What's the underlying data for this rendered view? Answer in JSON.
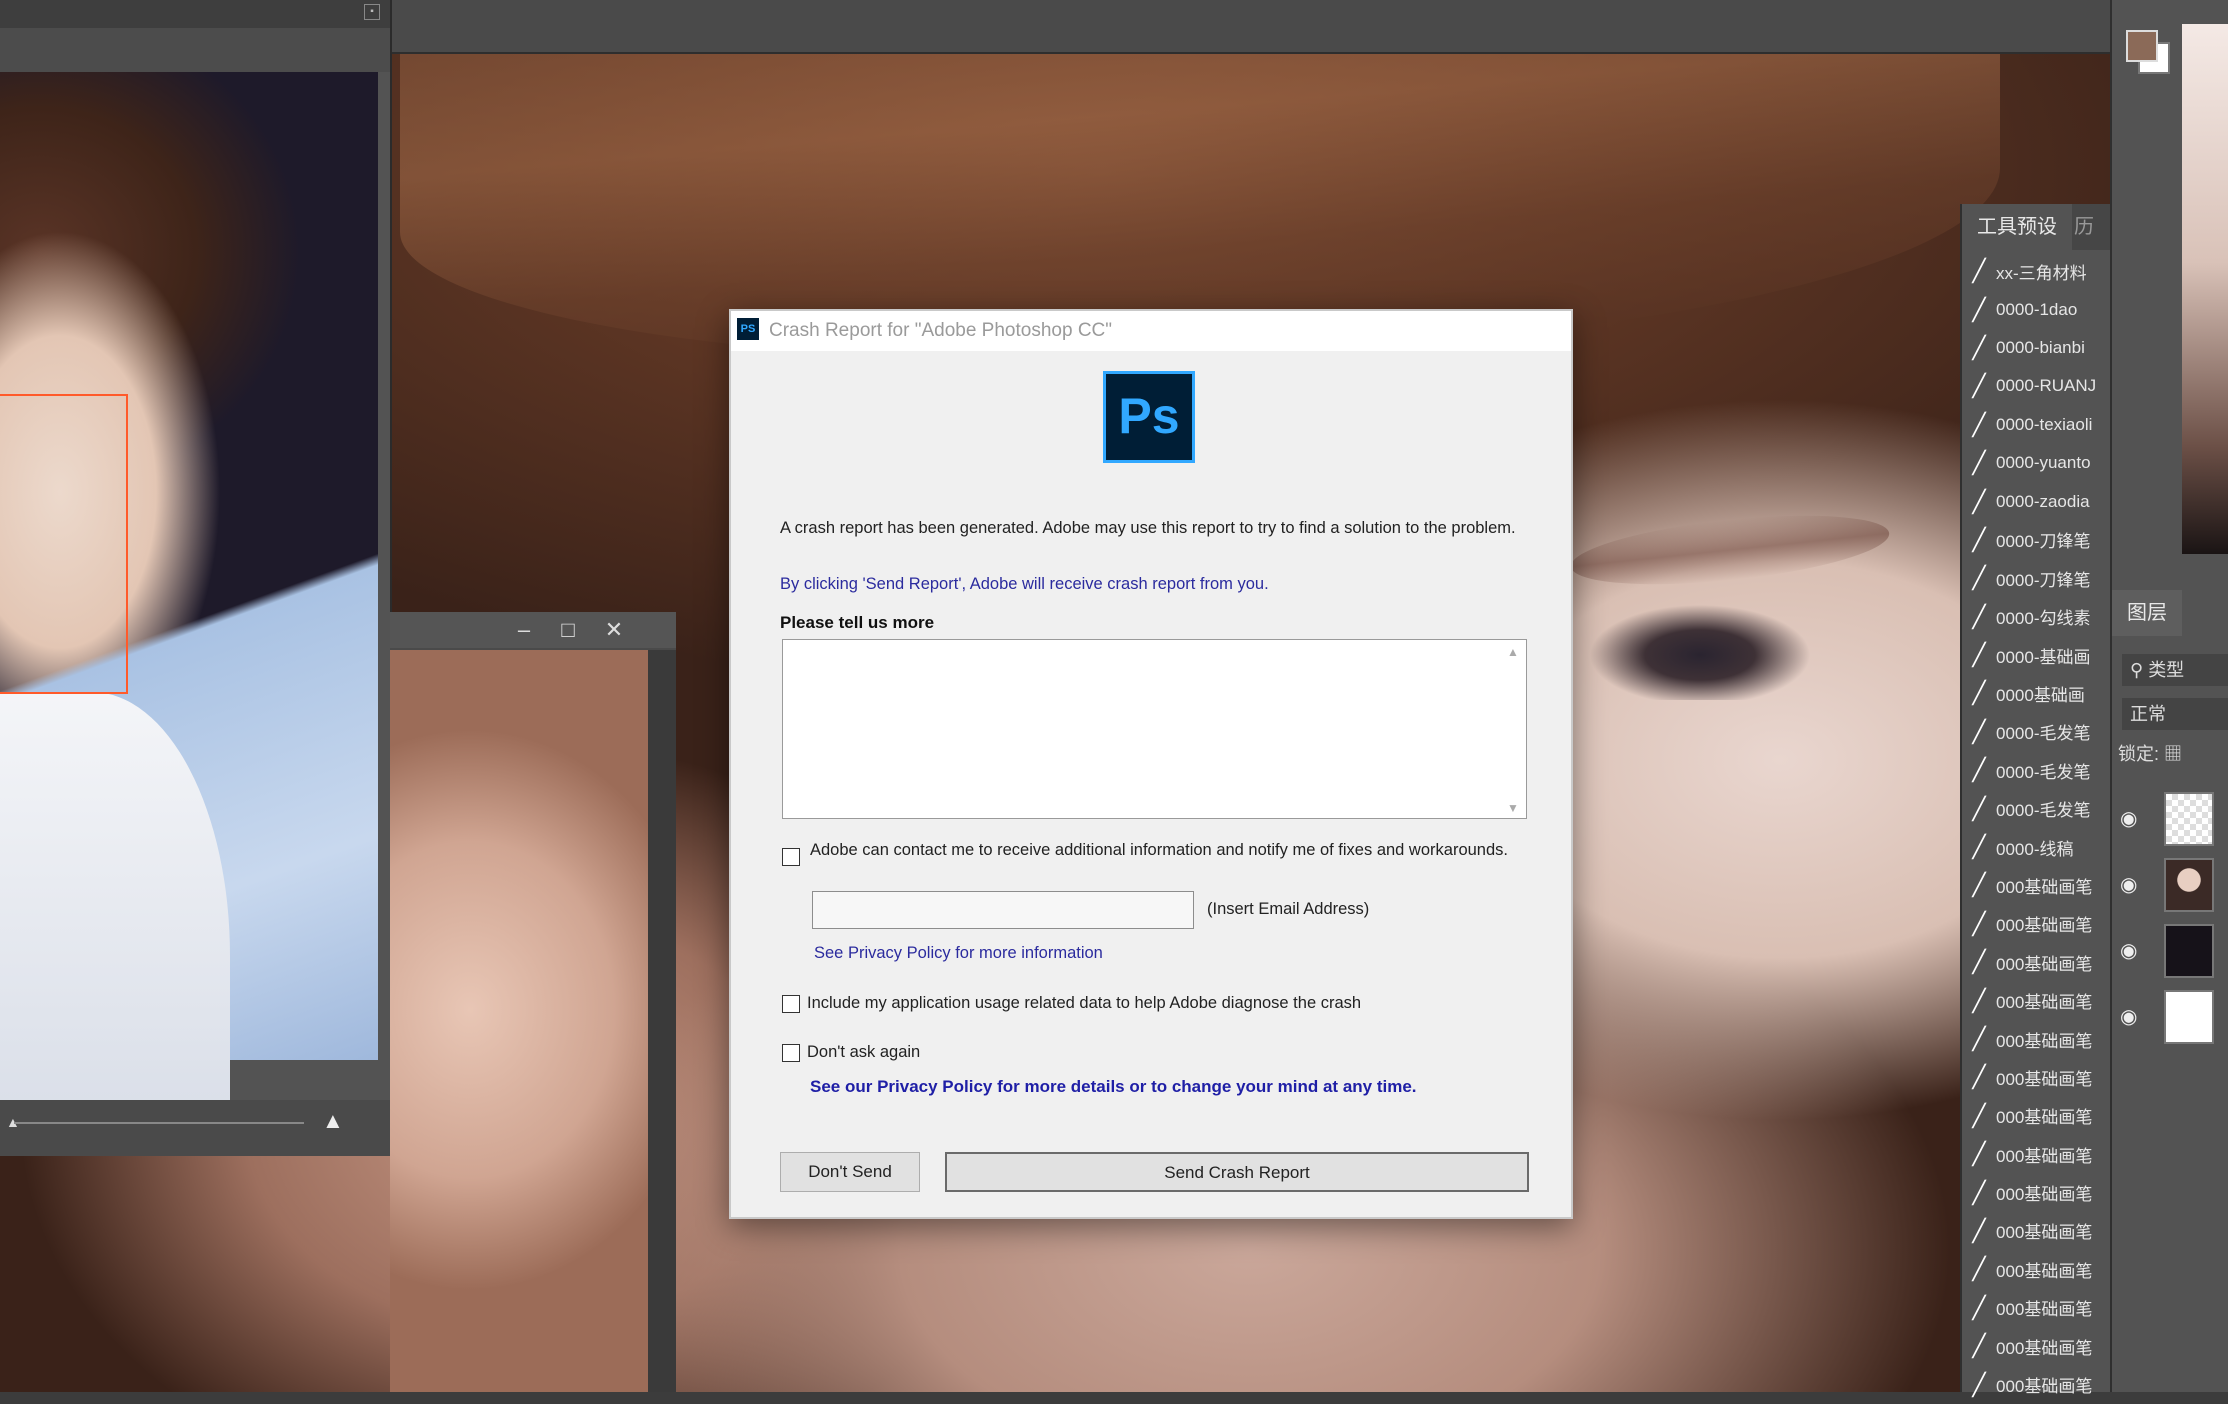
{
  "dialog": {
    "title": "Crash Report for \"Adobe Photoshop CC\"",
    "title_icon": "PS",
    "logo_text": "Ps",
    "message": "A crash report has been generated. Adobe may use this report to try to find a solution to the problem.",
    "info": "By clicking 'Send Report', Adobe will receive crash report from you.",
    "feedback_heading": "Please tell us more",
    "feedback_value": "",
    "contact_checkbox_label": "Adobe can contact me to receive additional information and notify me of fixes and workarounds.",
    "contact_checked": false,
    "email_value": "",
    "email_label": "(Insert Email Address)",
    "privacy_link": "See Privacy Policy for more information",
    "usage_checkbox_label": "Include my application usage related data to help Adobe diagnose the crash",
    "usage_checked": false,
    "dont_ask_label": "Don't ask again",
    "dont_ask_checked": false,
    "privacy_bold": "See our Privacy Policy for more details or to change your mind at any time.",
    "dont_send_label": "Don't Send",
    "send_label": "Send Crash Report"
  },
  "presets_panel": {
    "active_tab": "工具预设",
    "other_tab": "历",
    "items": [
      "xx-三角材料",
      "0000-1dao",
      "0000-bianbi",
      "0000-RUANJ",
      "0000-texiaoli",
      "0000-yuanto",
      "0000-zaodia",
      "0000-刀锋笔",
      "0000-刀锋笔",
      "0000-勾线素",
      "0000-基础画",
      "0000基础画",
      "0000-毛发笔",
      "0000-毛发笔",
      "0000-毛发笔",
      "0000-线稿",
      "000基础画笔",
      "000基础画笔",
      "000基础画笔",
      "000基础画笔",
      "000基础画笔",
      "000基础画笔",
      "000基础画笔",
      "000基础画笔",
      "000基础画笔",
      "000基础画笔",
      "000基础画笔",
      "000基础画笔",
      "000基础画笔",
      "000基础画笔"
    ]
  },
  "layers_panel": {
    "tab": "图层",
    "search": "类型",
    "blend_mode": "正常",
    "lock_label": "锁定:"
  },
  "colors": {
    "foreground": "#8b6a58",
    "background": "#ffffff",
    "ps_brand": "#31a8ff"
  },
  "icons": {
    "nav_collapse": "collapse-icon",
    "zoom_out": "small-mountain-icon",
    "zoom_in": "large-mountain-icon",
    "window_minimize": "minimize-icon",
    "window_maximize": "maximize-icon",
    "window_close": "close-icon",
    "brush": "brush-icon",
    "eye": "visibility-eye-icon"
  }
}
